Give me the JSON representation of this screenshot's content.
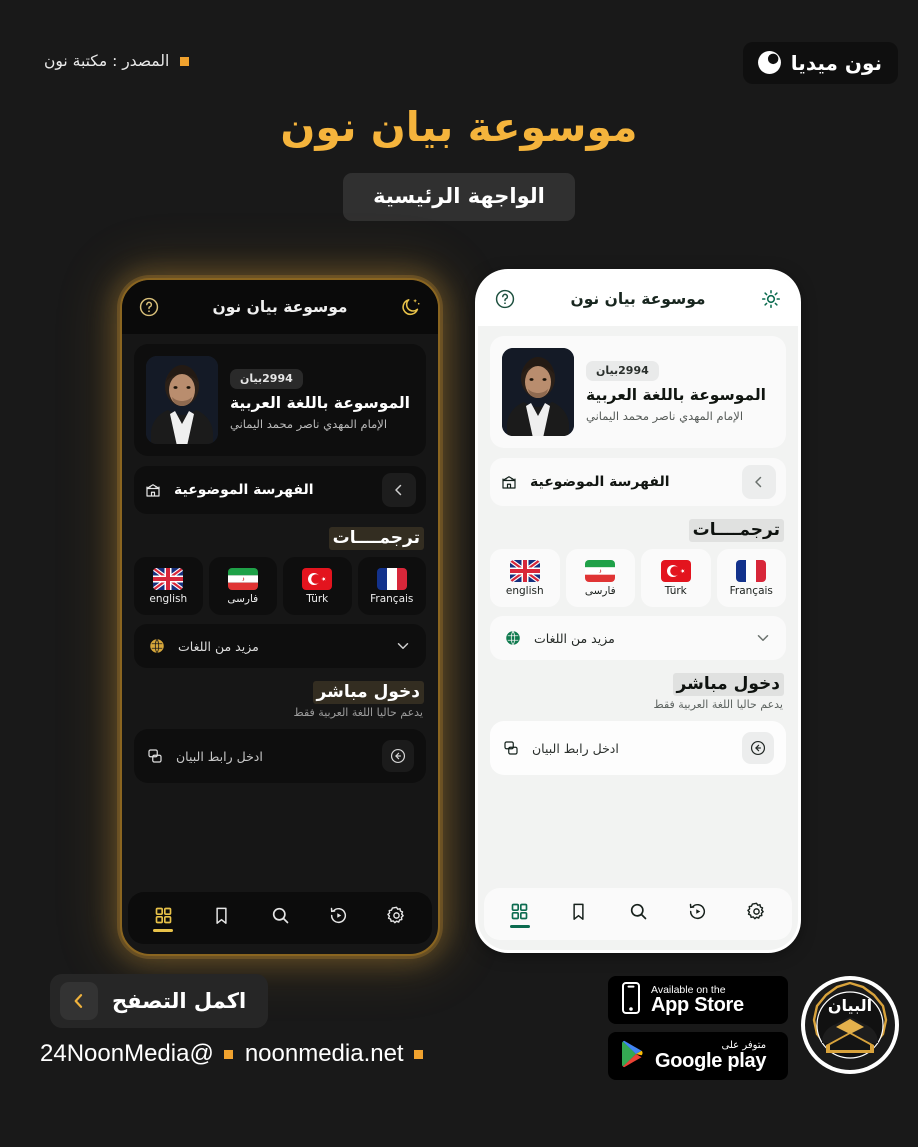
{
  "page": {
    "background": "#191919",
    "accent_gold": "#f5b43c",
    "accent_teal": "#0b6b4f"
  },
  "topbar": {
    "brand_name": "نون ميديا",
    "brand_icon": "crescent-circle-icon",
    "source_label": "المصدر : مكتبة نون"
  },
  "title": {
    "main": "موسوعة بيان نون",
    "chip": "الواجهة الرئيسية"
  },
  "app": {
    "header": {
      "title": "موسوعة بيان نون",
      "help_icon": "question-circle-icon",
      "theme_icon_dark": "crescent-moon-stars-icon",
      "theme_icon_light": "sun-icon"
    },
    "hero": {
      "count_chip": "2994بيان",
      "name": "الموسوعة باللغة العربية",
      "subtitle": "الإمام المهدي ناصر محمد اليماني",
      "avatar_name": "portrait-avatar"
    },
    "index_row": {
      "label": "الفهرسة الموضوعية",
      "icon": "archive-index-icon",
      "chevron": "chevron-left-icon"
    },
    "translations": {
      "heading": "ترجمــــات",
      "items": [
        {
          "label": "english",
          "flag": "flag-uk"
        },
        {
          "label": "فارسی",
          "flag": "flag-iran"
        },
        {
          "label": "Türk",
          "flag": "flag-turkey"
        },
        {
          "label": "Français",
          "flag": "flag-france"
        }
      ],
      "more_label": "مزيد من اللغات",
      "more_icon": "globe-icon",
      "more_chevron": "chevron-down-icon"
    },
    "direct": {
      "heading": "دخول مباشر",
      "note": "يدعم حاليا اللغة العربية فقط",
      "input_placeholder": "ادخل رابط البيان",
      "input_icon": "link-copy-icon",
      "go_icon": "arrow-left-circle-icon"
    },
    "nav": [
      {
        "name": "grid",
        "icon": "grid-icon",
        "active": true
      },
      {
        "name": "bookmark",
        "icon": "bookmark-icon",
        "active": false
      },
      {
        "name": "search",
        "icon": "search-icon",
        "active": false
      },
      {
        "name": "history",
        "icon": "history-play-icon",
        "active": false
      },
      {
        "name": "settings",
        "icon": "gear-icon",
        "active": false
      }
    ]
  },
  "footer": {
    "browse_button": "اكمل التصفح",
    "browse_icon": "chevron-left-icon",
    "handles": [
      {
        "text": "@24NoonMedia"
      },
      {
        "text": "noonmedia.net"
      }
    ],
    "appstore": {
      "small": "Available on the",
      "big": "App Store",
      "icon": "apple-phone-icon"
    },
    "googleplay": {
      "small": "متوفر على",
      "big": "Google play",
      "icon": "google-play-triangle-icon"
    },
    "badge_logo": "bayan-seal-logo"
  }
}
